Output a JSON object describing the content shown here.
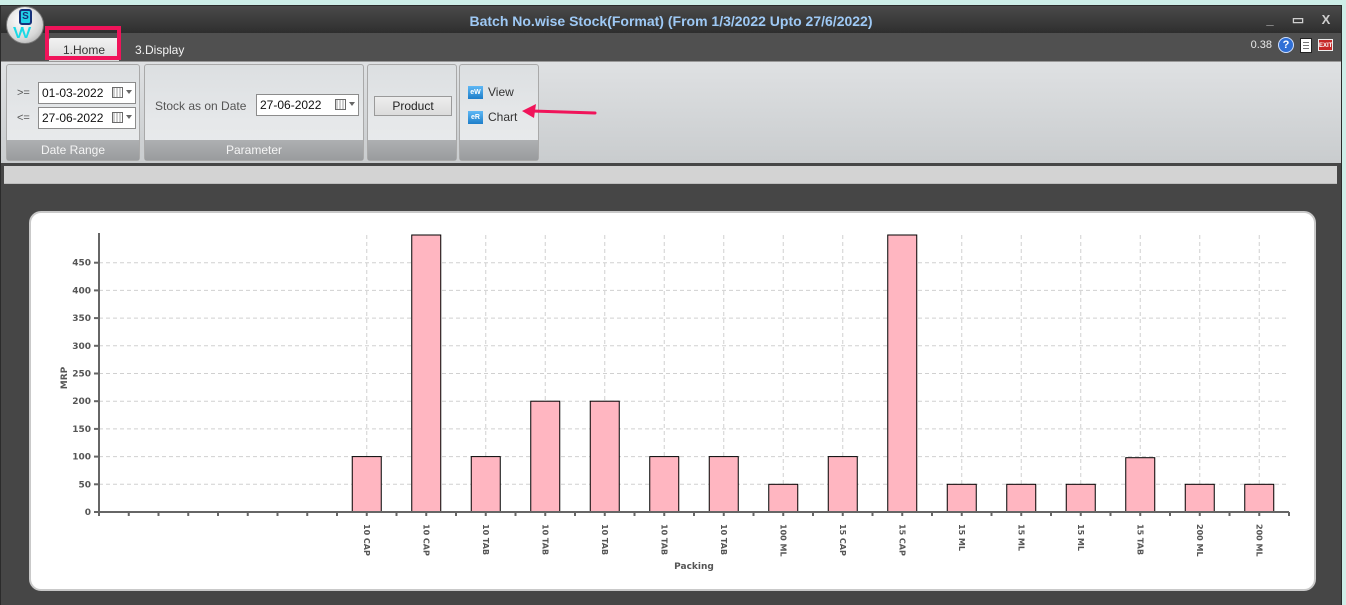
{
  "window": {
    "title": "Batch No.wise Stock(Format) (From 1/3/2022 Upto 27/6/2022)",
    "controls": {
      "minimize": "_",
      "maximize": "▭",
      "close": "X"
    }
  },
  "tabs": [
    {
      "label": "1.Home",
      "active": true
    },
    {
      "label": "3.Display",
      "active": false
    }
  ],
  "tab_right": {
    "version": "0.38",
    "help_icon": "?",
    "exit_icon": "EXIT"
  },
  "ribbon": {
    "date_range": {
      "group_label": "Date Range",
      "from_op": ">=",
      "from_value": "01-03-2022",
      "to_op": "<=",
      "to_value": "27-06-2022"
    },
    "parameter": {
      "group_label": "Parameter",
      "stock_label": "Stock as on Date",
      "stock_date": "27-06-2022"
    },
    "product": {
      "button_label": "Product"
    },
    "output": {
      "view_label": "View",
      "view_icon": "eW",
      "chart_label": "Chart",
      "chart_icon": "eR"
    }
  },
  "colors": {
    "bar_fill": "#ffb6c1",
    "bar_stroke": "#000000",
    "annotation": "#f0145a",
    "title_text": "#9ec9f5"
  },
  "chart_data": {
    "type": "bar",
    "title": "",
    "xlabel": "Packing",
    "ylabel": "MRP",
    "ylim": [
      0,
      500
    ],
    "yticks": [
      0,
      50,
      100,
      150,
      200,
      250,
      300,
      350,
      400,
      450
    ],
    "grid": true,
    "legend": "none",
    "categories": [
      "",
      "",
      "",
      "",
      "10 CAP",
      "10 CAP",
      "10 TAB",
      "10 TAB",
      "10 TAB",
      "10 TAB",
      "10 TAB",
      "100 ML",
      "15 CAP",
      "15 CAP",
      "15 ML",
      "15 ML",
      "15 ML",
      "15 TAB",
      "200 ML",
      "200 ML"
    ],
    "values": [
      0,
      0,
      0,
      0,
      100,
      500,
      100,
      200,
      200,
      100,
      100,
      50,
      100,
      500,
      50,
      50,
      50,
      98,
      50,
      50
    ]
  }
}
